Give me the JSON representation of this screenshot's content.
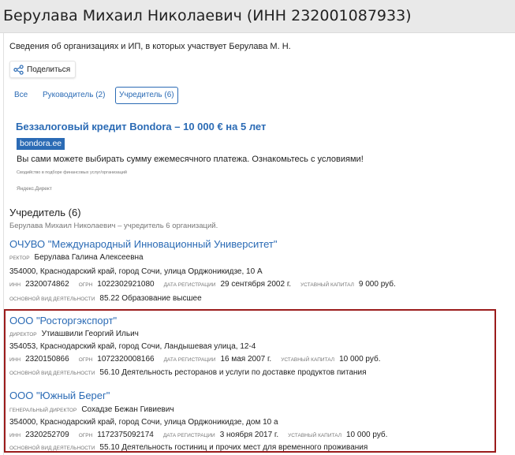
{
  "header": {
    "title": "Берулава Михаил Николаевич (ИНН 232001087933)"
  },
  "intro": "Сведения об организациях и ИП, в которых участвует Берулава М. Н.",
  "share": {
    "label": "Поделиться",
    "icon": "share-icon"
  },
  "tabs": [
    {
      "label": "Все"
    },
    {
      "label": "Руководитель (2)"
    },
    {
      "label": "Учредитель (6)",
      "active": true
    }
  ],
  "ad": {
    "title": "Беззалоговый кредит Bondora – 10 000 € на 5 лет",
    "domain": "bondora.ee",
    "text": "Вы сами можете выбирать сумму ежемесячного платежа. Ознакомьтесь с условиями!",
    "disclaimer": "Сводийство в подборе финансовых услуг/организаций",
    "source": "Яндекс.Директ"
  },
  "section": {
    "title": "Учредитель (6)",
    "subtitle": "Берулава Михаил Николаевич – учредитель 6 организаций."
  },
  "organizations": [
    {
      "name": "ОЧУВО \"Международный Инновационный Университет\"",
      "role_label": "ректор",
      "person": "Берулава Галина Алексеевна",
      "address": "354000, Краснодарский край, город Сочи, улица Орджоникидзе, 10 А",
      "inn_label": "ИНН",
      "inn": "2320074862",
      "ogrn_label": "ОГРН",
      "ogrn": "1022302921080",
      "reg_label": "Дата регистрации",
      "reg": "29 сентября 2002 г.",
      "cap_label": "уставный капитал",
      "cap": "9 000 руб.",
      "activity_label": "основной вид деятельности",
      "activity": "85.22 Образование высшее"
    },
    {
      "name": "ООО \"Росторгэкспорт\"",
      "role_label": "директор",
      "person": "Утиашвили Георгий Ильич",
      "address": "354053, Краснодарский край, город Сочи, Ландышевая улица, 12-4",
      "inn_label": "ИНН",
      "inn": "2320150866",
      "ogrn_label": "ОГРН",
      "ogrn": "1072320008166",
      "reg_label": "Дата регистрации",
      "reg": "16 мая 2007 г.",
      "cap_label": "уставный капитал",
      "cap": "10 000 руб.",
      "activity_label": "основной вид деятельности",
      "activity": "56.10 Деятельность ресторанов и услуги по доставке продуктов питания"
    },
    {
      "name": "ООО \"Южный Берег\"",
      "role_label": "генеральный директор",
      "person": "Сохадзе Бежан Гивиевич",
      "address": "354000, Краснодарский край, город Сочи, улица Орджоникидзе, дом 10 а",
      "inn_label": "ИНН",
      "inn": "2320252709",
      "ogrn_label": "ОГРН",
      "ogrn": "1172375092174",
      "reg_label": "Дата регистрации",
      "reg": "3 ноября 2017 г.",
      "cap_label": "уставный капитал",
      "cap": "10 000 руб.",
      "activity_label": "основной вид деятельности",
      "activity": "55.10 Деятельность гостиниц и прочих мест для временного проживания"
    }
  ],
  "colors": {
    "link": "#2b6bb5",
    "highlight_border": "#9b1c1c",
    "header_bg": "#e9e9e9"
  }
}
